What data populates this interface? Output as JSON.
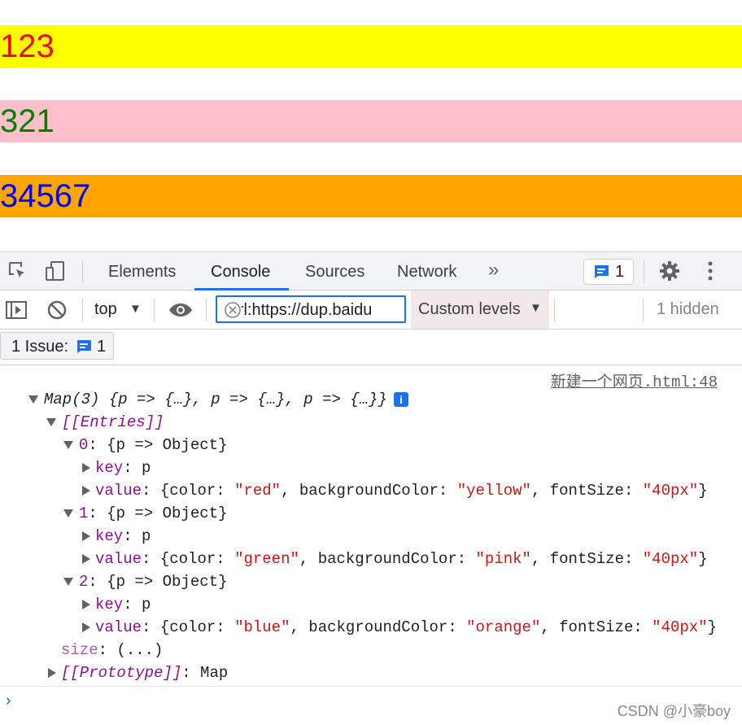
{
  "page": {
    "paragraphs": [
      {
        "text": "123",
        "color": "#ff0000",
        "background": "#ffff00"
      },
      {
        "text": "321",
        "color": "#008000",
        "background": "#ffc0cb"
      },
      {
        "text": "34567",
        "color": "#0000ff",
        "background": "#ffa500"
      }
    ]
  },
  "devtools": {
    "tabs": [
      "Elements",
      "Console",
      "Sources",
      "Network"
    ],
    "active_tab": "Console",
    "more_tabs_glyph": "»",
    "issues_badge_count": "1",
    "settings_icon": "gear-icon",
    "menu_icon": "kebab-menu-icon",
    "context": "top",
    "filter_value": "-url:https://dup.baidu",
    "levels_label": "Custom levels",
    "hidden_label": "1 hidden",
    "issue_bar": {
      "label": "1 Issue:",
      "count": "1"
    }
  },
  "console": {
    "source_link": "新建一个网页.html:48",
    "map_summary": {
      "prefix": "Map(3) ",
      "body": "{p => {…}, p => {…}, p => {…}}"
    },
    "entries_label": "[[Entries]]",
    "entries": [
      {
        "index": "0",
        "value": {
          "color": "\"red\"",
          "backgroundColor": "\"yellow\"",
          "fontSize": "\"40px\""
        }
      },
      {
        "index": "1",
        "value": {
          "color": "\"green\"",
          "backgroundColor": "\"pink\"",
          "fontSize": "\"40px\""
        }
      },
      {
        "index": "2",
        "value": {
          "color": "\"blue\"",
          "backgroundColor": "\"orange\"",
          "fontSize": "\"40px\""
        }
      }
    ],
    "entry_head_suffix": ": {p => Object}",
    "key_label": "key",
    "key_value": "p",
    "value_label": "value",
    "size_label": "size",
    "size_value": "(...)",
    "prototype_label": "[[Prototype]]",
    "prototype_value": "Map"
  },
  "watermark": "CSDN @小豪boy"
}
